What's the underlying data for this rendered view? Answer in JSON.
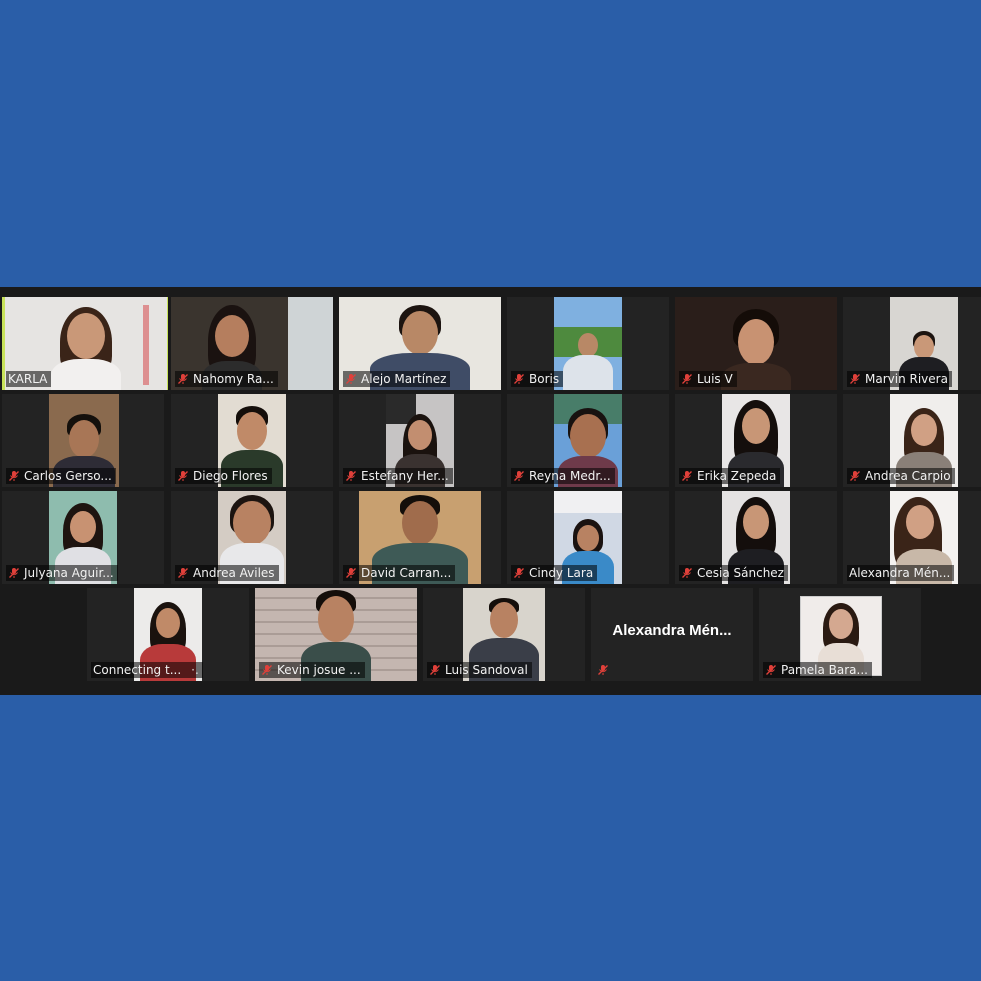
{
  "meeting": {
    "participants": [
      {
        "name": "KARLA",
        "muted": false,
        "active": true,
        "video": true
      },
      {
        "name": "Nahomy Ra...",
        "muted": true,
        "video": true
      },
      {
        "name": "Alejo Martínez",
        "muted": true,
        "video": true
      },
      {
        "name": "Boris",
        "muted": true,
        "video": true
      },
      {
        "name": "Luis V",
        "muted": true,
        "video": true
      },
      {
        "name": "Marvin Rivera",
        "muted": true,
        "video": true
      },
      {
        "name": "Carlos Gerso...",
        "muted": true,
        "video": true
      },
      {
        "name": "Diego Flores",
        "muted": true,
        "video": true
      },
      {
        "name": "Estefany Her...",
        "muted": true,
        "video": true
      },
      {
        "name": "Reyna Medr...",
        "muted": true,
        "video": true
      },
      {
        "name": "Erika Zepeda",
        "muted": true,
        "video": true
      },
      {
        "name": "Andrea Carpio",
        "muted": true,
        "video": true
      },
      {
        "name": "Julyana Aguir...",
        "muted": true,
        "video": true
      },
      {
        "name": "Andrea Aviles",
        "muted": true,
        "video": true
      },
      {
        "name": "David Carran...",
        "muted": true,
        "video": true
      },
      {
        "name": "Cindy Lara",
        "muted": true,
        "video": true
      },
      {
        "name": "Cesia Sánchez",
        "muted": true,
        "video": true
      },
      {
        "name": "Alexandra Mén...",
        "muted": false,
        "video": true
      },
      {
        "name": "Connecting t...",
        "muted": false,
        "video": true,
        "status": "connecting"
      },
      {
        "name": "Kevin josue ...",
        "muted": true,
        "video": true
      },
      {
        "name": "Luis Sandoval",
        "muted": true,
        "video": true
      },
      {
        "name": "Alexandra  Mén...",
        "muted": true,
        "video": false
      },
      {
        "name": "Pamela Bara...",
        "muted": true,
        "video": true
      }
    ],
    "connecting_indicator": "·.",
    "colors": {
      "background": "#2a5ea8",
      "gallery": "#1a1a1a",
      "tile": "#232323",
      "active_speaker_border": "#c8e25a",
      "muted_icon": "#e0403a"
    }
  }
}
